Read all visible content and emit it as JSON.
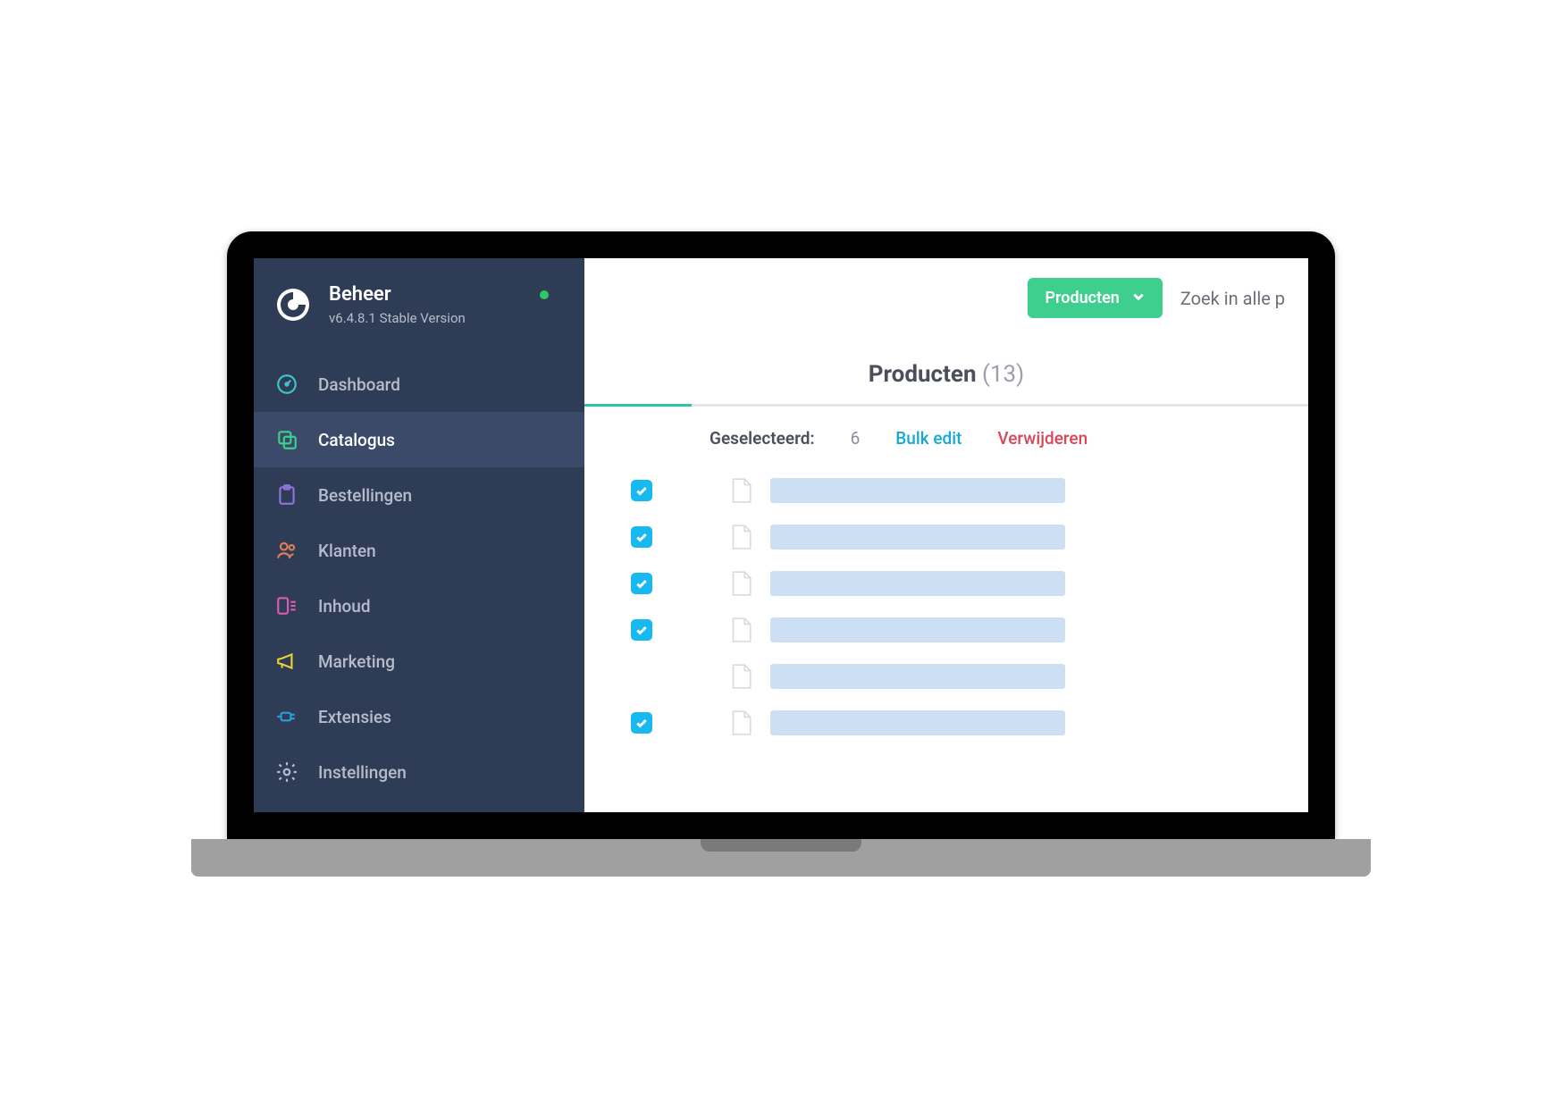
{
  "brand": {
    "title": "Beheer",
    "version": "v6.4.8.1 Stable Version",
    "status_color": "#2ec760"
  },
  "sidebar": {
    "items": [
      {
        "label": "Dashboard",
        "icon": "speedometer-icon",
        "color": "#3dc5c7",
        "active": false
      },
      {
        "label": "Catalogus",
        "icon": "copy-icon",
        "color": "#3ecf8e",
        "active": true
      },
      {
        "label": "Bestellingen",
        "icon": "clipboard-icon",
        "color": "#8d74d6",
        "active": false
      },
      {
        "label": "Klanten",
        "icon": "users-icon",
        "color": "#e07b57",
        "active": false
      },
      {
        "label": "Inhoud",
        "icon": "layout-icon",
        "color": "#d95bb0",
        "active": false
      },
      {
        "label": "Marketing",
        "icon": "megaphone-icon",
        "color": "#e8d132",
        "active": false
      },
      {
        "label": "Extensies",
        "icon": "plug-icon",
        "color": "#2b9dd6",
        "active": false
      },
      {
        "label": "Instellingen",
        "icon": "gear-icon",
        "color": "#b7bcca",
        "active": false
      }
    ]
  },
  "topbar": {
    "dropdown_label": "Producten",
    "search_placeholder": "Zoek in alle p"
  },
  "page": {
    "title_text": "Producten",
    "count": 13
  },
  "toolbar": {
    "selected_label": "Geselecteerd:",
    "selected_count": 6,
    "bulk_edit_label": "Bulk edit",
    "delete_label": "Verwijderen"
  },
  "rows": [
    {
      "checked": true
    },
    {
      "checked": true
    },
    {
      "checked": true
    },
    {
      "checked": true
    },
    {
      "checked": false
    },
    {
      "checked": true
    }
  ],
  "colors": {
    "sidebar_bg": "#2f3c56",
    "accent": "#3ecf8e",
    "checkbox": "#18b9f0",
    "link": "#15a9d4",
    "danger": "#d9465a"
  }
}
